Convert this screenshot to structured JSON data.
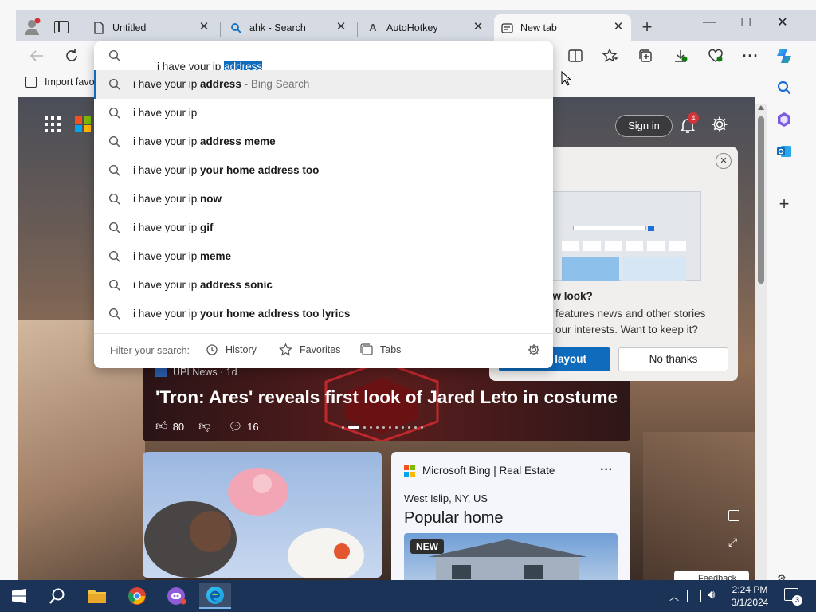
{
  "window": {
    "tabs": [
      {
        "title": "Untitled",
        "icon": "document-icon"
      },
      {
        "title": "ahk - Search",
        "icon": "search-icon"
      },
      {
        "title": "AutoHotkey",
        "icon": "autohotkey-icon"
      },
      {
        "title": "New tab",
        "icon": "newtab-icon",
        "active": true
      }
    ],
    "controls": {
      "minimize": "—",
      "maximize": "☐",
      "close": "✕"
    }
  },
  "address_bar": {
    "typed": "i have your ip ",
    "selected_completion": "address"
  },
  "favorites_bar": {
    "import_label": "Import favo"
  },
  "suggestions": [
    {
      "prefix": "i have your ip ",
      "bold": "address",
      "suffix": " - Bing Search",
      "highlighted": true
    },
    {
      "prefix": "i have your ip",
      "bold": "",
      "suffix": ""
    },
    {
      "prefix": "i have your ip ",
      "bold": "address meme",
      "suffix": ""
    },
    {
      "prefix": "i have your ip ",
      "bold": "your home address too",
      "suffix": ""
    },
    {
      "prefix": "i have your ip ",
      "bold": "now",
      "suffix": ""
    },
    {
      "prefix": "i have your ip ",
      "bold": "gif",
      "suffix": ""
    },
    {
      "prefix": "i have your ip ",
      "bold": "meme",
      "suffix": ""
    },
    {
      "prefix": "i have your ip ",
      "bold": "address sonic",
      "suffix": ""
    },
    {
      "prefix": "i have your ip ",
      "bold": "your home address too lyrics",
      "suffix": ""
    }
  ],
  "filter": {
    "label": "Filter your search:",
    "history": "History",
    "favorites": "Favorites",
    "tabs": "Tabs"
  },
  "newtab": {
    "sign_in": "Sign in",
    "notification_count": "4",
    "popup": {
      "question": "ew look?",
      "body_line1": "features news and other stories",
      "body_line2": "our interests. Want to keep it?",
      "keep_button": "layout",
      "no_button": "No thanks"
    },
    "headline_source": "UPI News · 1d",
    "headline": "'Tron: Ares' reveals first look of Jared Leto in costume",
    "likes": "80",
    "comments": "16",
    "card3": {
      "source": "Microsoft Bing | Real Estate",
      "location": "West Islip, NY, US",
      "title": "Popular home",
      "badge": "NEW"
    },
    "feedback": "Feedback"
  },
  "taskbar": {
    "time": "2:24 PM",
    "date": "3/1/2024",
    "notifications": "3"
  },
  "colors": {
    "accent": "#0f6cbd",
    "selection": "#0f6cbd",
    "taskbar": "#1b3356",
    "tabstrip": "#d6dbe3"
  }
}
